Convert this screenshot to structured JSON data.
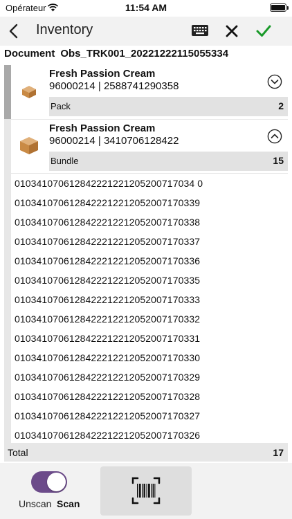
{
  "status_bar": {
    "carrier": "Opérateur",
    "time": "11:54 AM"
  },
  "nav": {
    "title": "Inventory",
    "icons": [
      "back-chevron-icon",
      "keyboard-icon",
      "close-icon",
      "checkmark-icon"
    ],
    "accent_check": "#1a9a2a"
  },
  "document": {
    "label": "Document",
    "value": "Obs_TRK001_20221222115055334"
  },
  "items": [
    {
      "name": "Fresh Passion Cream",
      "codes": "96000214 | 2588741290358",
      "unit": "Pack",
      "qty": "2",
      "expanded": false,
      "icon": "box-icon"
    },
    {
      "name": "Fresh Passion Cream",
      "codes": "96000214 | 3410706128422",
      "unit": "Bundle",
      "qty": "15",
      "expanded": true,
      "icon": "box-icon"
    }
  ],
  "serials": [
    "010341070612842221221205200717034 0",
    "0103410706128422212212052007170339",
    "0103410706128422212212052007170338",
    "0103410706128422212212052007170337",
    "0103410706128422212212052007170336",
    "0103410706128422212212052007170335",
    "0103410706128422212212052007170333",
    "0103410706128422212212052007170332",
    "0103410706128422212212052007170331",
    "0103410706128422212212052007170330",
    "0103410706128422212212052007170329",
    "0103410706128422212212052007170328",
    "0103410706128422212212052007170327",
    "0103410706128422212212052007170326"
  ],
  "total": {
    "label": "Total",
    "value": "17"
  },
  "bottom": {
    "unscan_label": "Unscan",
    "scan_label": "Scan",
    "switch_on": true,
    "switch_color": "#6c4b8a",
    "scan_icon": "barcode-scan-icon"
  }
}
